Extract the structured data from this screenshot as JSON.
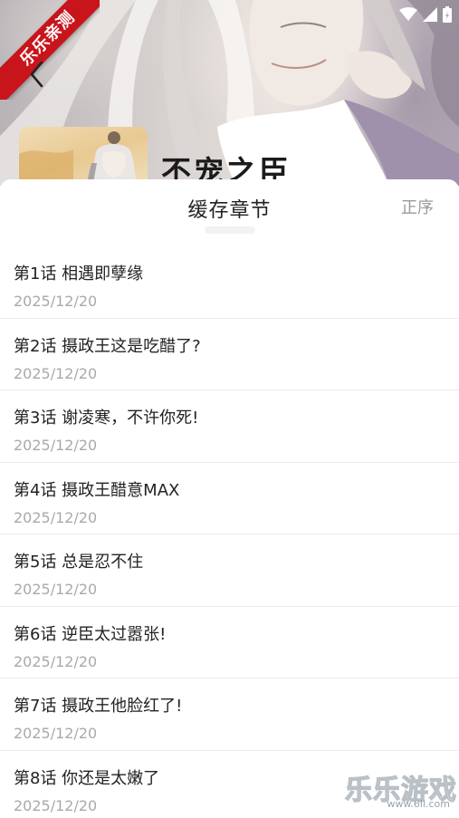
{
  "status_bar": {
    "icons": [
      "wifi-icon",
      "signal-icon",
      "battery-icon"
    ]
  },
  "ribbon": {
    "label": "乐乐亲测"
  },
  "header": {
    "back_icon": "chevron-left-icon",
    "comic_title": "不宠之臣"
  },
  "sheet": {
    "title": "缓存章节",
    "sort_label": "正序",
    "chapters": [
      {
        "title": "第1话 相遇即孽缘",
        "date": "2025/12/20"
      },
      {
        "title": "第2话 摄政王这是吃醋了?",
        "date": "2025/12/20"
      },
      {
        "title": "第3话 谢凌寒，不许你死!",
        "date": "2025/12/20"
      },
      {
        "title": "第4话 摄政王醋意MAX",
        "date": "2025/12/20"
      },
      {
        "title": "第5话 总是忍不住",
        "date": "2025/12/20"
      },
      {
        "title": "第6话 逆臣太过嚣张!",
        "date": "2025/12/20"
      },
      {
        "title": "第7话 摄政王他脸红了!",
        "date": "2025/12/20"
      },
      {
        "title": "第8话 你还是太嫩了",
        "date": "2025/12/20"
      }
    ]
  },
  "watermark": {
    "text": "乐乐游戏",
    "url": "www.6ll.com"
  },
  "colors": {
    "ribbon": "#c8141b",
    "sheet_bg": "#ffffff",
    "divider": "#ececec",
    "date": "#a9a9a9",
    "sort": "#9a9a9a"
  }
}
